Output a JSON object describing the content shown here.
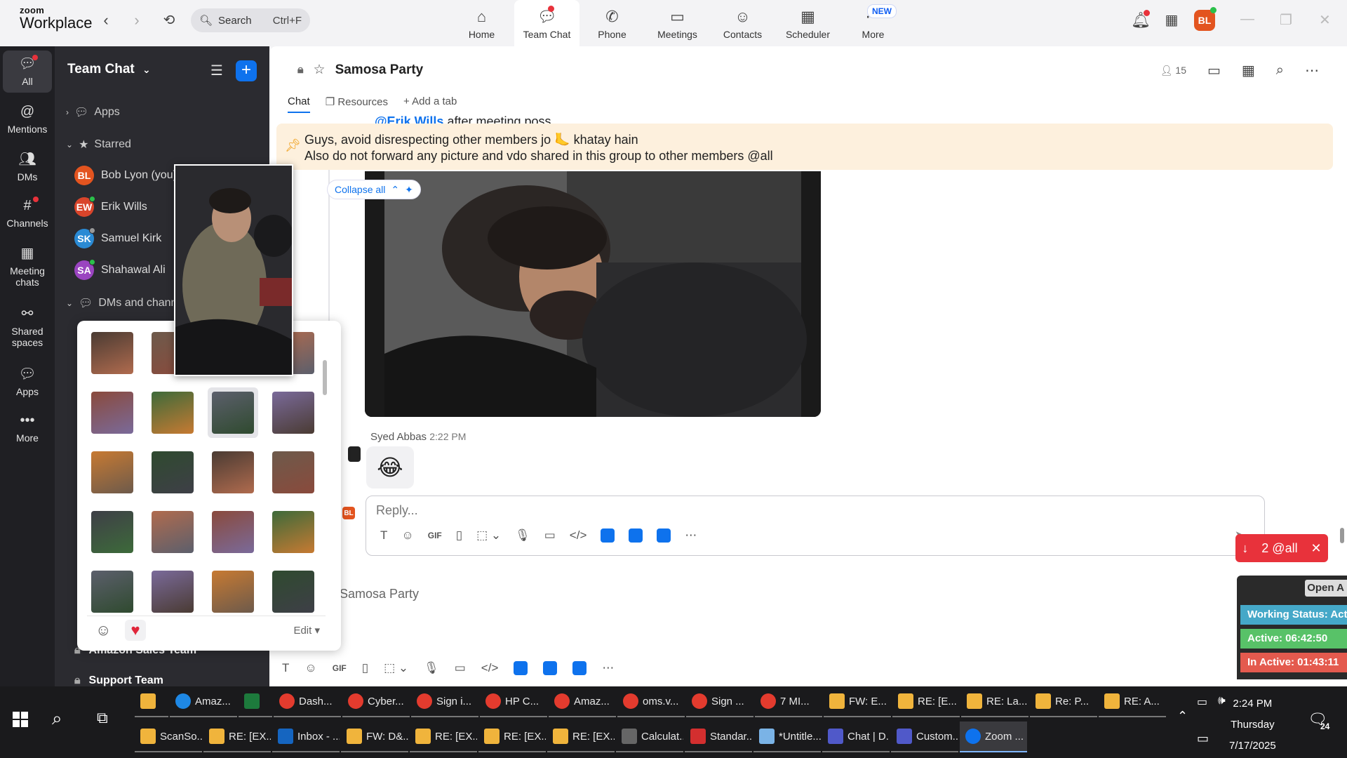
{
  "topbar": {
    "logo_line1": "zoom",
    "logo_line2": "Workplace",
    "search_placeholder": "Search",
    "search_shortcut": "Ctrl+F",
    "tabs": [
      {
        "label": "Home",
        "icon": "home-icon"
      },
      {
        "label": "Team Chat",
        "icon": "chat-icon"
      },
      {
        "label": "Phone",
        "icon": "phone-icon"
      },
      {
        "label": "Meetings",
        "icon": "video-icon"
      },
      {
        "label": "Contacts",
        "icon": "contacts-icon"
      },
      {
        "label": "Scheduler",
        "icon": "scheduler-icon"
      },
      {
        "label": "More",
        "icon": "more-icon"
      }
    ],
    "new_badge": "NEW",
    "user_initials": "BL"
  },
  "rail": {
    "items": [
      {
        "label": "All"
      },
      {
        "label": "Mentions"
      },
      {
        "label": "DMs"
      },
      {
        "label": "Channels"
      },
      {
        "label": "Meeting chats"
      },
      {
        "label": "Shared spaces"
      },
      {
        "label": "Apps"
      },
      {
        "label": "More"
      }
    ]
  },
  "panel": {
    "title": "Team Chat",
    "sections": {
      "apps": "Apps",
      "starred": "Starred",
      "dms": "DMs and channels"
    },
    "starred": [
      {
        "initials": "BL",
        "name": "Bob Lyon (you)",
        "color": "#e3541f"
      },
      {
        "initials": "EW",
        "name": "Erik Wills",
        "color": "#d9452b"
      },
      {
        "initials": "SK",
        "name": "Samuel Kirk",
        "color": "#2a8ad4"
      },
      {
        "initials": "SA",
        "name": "Shahawal Ali",
        "color": "#9a44c0"
      }
    ],
    "bottom_items": [
      "Amazon Sales Team",
      "Support Team"
    ]
  },
  "channel": {
    "name": "Samosa Party",
    "member_count": "15",
    "tabs": [
      "Chat",
      "Resources",
      "Add a tab"
    ],
    "partial_line_mention": "@Erik Wills",
    "partial_line_text": "after meeting poss",
    "pinned_line1": "Guys, avoid disrespecting other members jo 🦶 khatay hain",
    "pinned_line2": "Also do not forward any picture and vdo shared in this group to other members @all",
    "collapse_label": "Collapse all",
    "message_sender": "Syed Abbas",
    "message_time": "2:22 PM",
    "message_emoji": "😂",
    "reply_placeholder": "Reply...",
    "gif_label": "GIF",
    "at_all_label": "2 @all",
    "compose_channel_name": "Samosa Party"
  },
  "status_widget": {
    "open_label": "Open A",
    "working": "Working Status: Acti",
    "active": "Active: 06:42:50",
    "inactive": "In Active: 01:43:11"
  },
  "sticker_picker": {
    "edit_label": "Edit",
    "sticker_count": 20
  },
  "taskbar": {
    "row1": [
      {
        "label": "",
        "color": "#f0b43c",
        "shape": "sq"
      },
      {
        "label": "Amaz...",
        "color": "#1e88e5",
        "shape": "round"
      },
      {
        "label": "",
        "color": "#1d7a3c",
        "shape": "sq"
      },
      {
        "label": "Dash...",
        "color": "#e33b2e",
        "shape": "round"
      },
      {
        "label": "Cyber...",
        "color": "#e33b2e",
        "shape": "round"
      },
      {
        "label": "Sign i...",
        "color": "#e33b2e",
        "shape": "round"
      },
      {
        "label": "HP C...",
        "color": "#e33b2e",
        "shape": "round"
      },
      {
        "label": "Amaz...",
        "color": "#e33b2e",
        "shape": "round"
      },
      {
        "label": "oms.v...",
        "color": "#e33b2e",
        "shape": "round"
      },
      {
        "label": "Sign ...",
        "color": "#e33b2e",
        "shape": "round"
      },
      {
        "label": "7 MI...",
        "color": "#e33b2e",
        "shape": "round"
      },
      {
        "label": "FW: E...",
        "color": "#f0b43c",
        "shape": "sq"
      },
      {
        "label": "RE: [E...",
        "color": "#f0b43c",
        "shape": "sq"
      },
      {
        "label": "RE: La...",
        "color": "#f0b43c",
        "shape": "sq"
      },
      {
        "label": "Re: P...",
        "color": "#f0b43c",
        "shape": "sq"
      },
      {
        "label": "RE: A...",
        "color": "#f0b43c",
        "shape": "sq"
      }
    ],
    "row2": [
      {
        "label": "ScanSo...",
        "color": "#f0b43c",
        "shape": "sq"
      },
      {
        "label": "RE: [EX...",
        "color": "#f0b43c",
        "shape": "sq"
      },
      {
        "label": "Inbox - ...",
        "color": "#1565c0",
        "shape": "sq"
      },
      {
        "label": "FW: D&...",
        "color": "#f0b43c",
        "shape": "sq"
      },
      {
        "label": "RE: [EX...",
        "color": "#f0b43c",
        "shape": "sq"
      },
      {
        "label": "RE: [EX...",
        "color": "#f0b43c",
        "shape": "sq"
      },
      {
        "label": "RE: [EX...",
        "color": "#f0b43c",
        "shape": "sq"
      },
      {
        "label": "Calculat...",
        "color": "#666",
        "shape": "sq"
      },
      {
        "label": "Standar...",
        "color": "#d32f2f",
        "shape": "sq"
      },
      {
        "label": "*Untitle...",
        "color": "#7ab3e6",
        "shape": "sq"
      },
      {
        "label": "Chat | D...",
        "color": "#5059c9",
        "shape": "sq"
      },
      {
        "label": "Custom...",
        "color": "#5059c9",
        "shape": "sq"
      },
      {
        "label": "Zoom ...",
        "color": "#0e72ed",
        "shape": "round"
      }
    ],
    "time": "2:24 PM",
    "day": "Thursday",
    "date": "7/17/2025",
    "notif_count": "24"
  }
}
